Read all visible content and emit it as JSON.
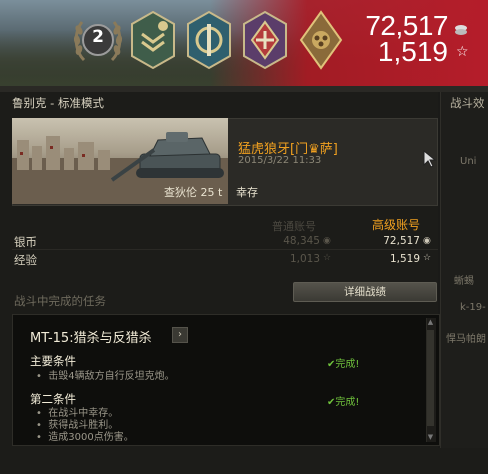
{
  "header": {
    "mastery_badge_number": "2",
    "reward_silver": "72,517",
    "reward_xp": "1,519",
    "medals": [
      "medal-chevron-icon",
      "medal-sword-icon",
      "medal-tank-icon",
      "medal-knuckle-icon"
    ]
  },
  "panel": {
    "title": "鲁别克 - 标准模式",
    "right_title": "战斗效",
    "right_snippets": [
      "Uni",
      "蜥蜴",
      "k-19-",
      "悍马帕朗"
    ]
  },
  "battle": {
    "player": "猛虎狼牙[门♛萨]",
    "datetime": "2015/3/22 11:33",
    "tank": "查狄伦 25 t",
    "result": "幸存"
  },
  "earnings": {
    "basic_header": "普通账号",
    "premium_header": "高级账号",
    "rows": [
      {
        "label": "银币",
        "basic": "48,345",
        "premium": "72,517",
        "currency_icon": "silver-icon"
      },
      {
        "label": "经验",
        "basic": "1,013",
        "premium": "1,519",
        "currency_icon": "xp-star-icon"
      }
    ]
  },
  "missions": {
    "section_title": "战斗中完成的任务",
    "detail_button": "详细战绩",
    "mission_name": "MT-15:猎杀与反猎杀",
    "main_condition_title": "主要条件",
    "main_condition_items": [
      "击毁4辆敌方自行反坦克炮。"
    ],
    "main_status": "完成!",
    "second_condition_title": "第二条件",
    "second_condition_items": [
      "在战斗中幸存。",
      "获得战斗胜利。",
      "造成3000点伤害。"
    ],
    "second_status": "完成!"
  },
  "colors": {
    "accent_gold": "#f0a020",
    "complete_green": "#6fc13c",
    "banner_red": "#b51d2a"
  }
}
